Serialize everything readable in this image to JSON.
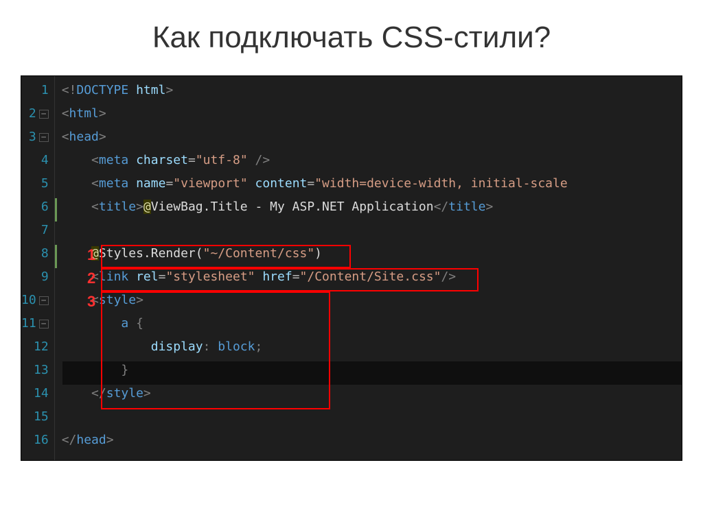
{
  "slide": {
    "title": "Как подключать CSS-стили?"
  },
  "highlights": {
    "label1": "1",
    "label2": "2",
    "label3": "3"
  },
  "lines": [
    {
      "num": "1",
      "fold": "",
      "tokens": [
        {
          "cls": "tok-punc",
          "t": "<!"
        },
        {
          "cls": "tok-tag",
          "t": "DOCTYPE"
        },
        {
          "cls": "tok-plain",
          "t": " "
        },
        {
          "cls": "tok-attr",
          "t": "html"
        },
        {
          "cls": "tok-punc",
          "t": ">"
        }
      ]
    },
    {
      "num": "2",
      "fold": "−",
      "tokens": [
        {
          "cls": "tok-punc",
          "t": "<"
        },
        {
          "cls": "tok-tag",
          "t": "html"
        },
        {
          "cls": "tok-punc",
          "t": ">"
        }
      ]
    },
    {
      "num": "3",
      "fold": "−",
      "tokens": [
        {
          "cls": "tok-punc",
          "t": "<"
        },
        {
          "cls": "tok-tag",
          "t": "head"
        },
        {
          "cls": "tok-punc",
          "t": ">"
        }
      ]
    },
    {
      "num": "4",
      "fold": "",
      "tokens": [
        {
          "cls": "tok-plain",
          "t": "    "
        },
        {
          "cls": "tok-punc",
          "t": "<"
        },
        {
          "cls": "tok-tag",
          "t": "meta"
        },
        {
          "cls": "tok-plain",
          "t": " "
        },
        {
          "cls": "tok-attr",
          "t": "charset"
        },
        {
          "cls": "tok-op",
          "t": "="
        },
        {
          "cls": "tok-str",
          "t": "\"utf-8\""
        },
        {
          "cls": "tok-plain",
          "t": " "
        },
        {
          "cls": "tok-punc",
          "t": "/>"
        }
      ]
    },
    {
      "num": "5",
      "fold": "",
      "tokens": [
        {
          "cls": "tok-plain",
          "t": "    "
        },
        {
          "cls": "tok-punc",
          "t": "<"
        },
        {
          "cls": "tok-tag",
          "t": "meta"
        },
        {
          "cls": "tok-plain",
          "t": " "
        },
        {
          "cls": "tok-attr",
          "t": "name"
        },
        {
          "cls": "tok-op",
          "t": "="
        },
        {
          "cls": "tok-str",
          "t": "\"viewport\""
        },
        {
          "cls": "tok-plain",
          "t": " "
        },
        {
          "cls": "tok-attr",
          "t": "content"
        },
        {
          "cls": "tok-op",
          "t": "="
        },
        {
          "cls": "tok-str",
          "t": "\"width=device-width, initial-scale"
        }
      ]
    },
    {
      "num": "6",
      "fold": "",
      "tokens": [
        {
          "cls": "tok-plain",
          "t": "    "
        },
        {
          "cls": "tok-punc",
          "t": "<"
        },
        {
          "cls": "tok-tag",
          "t": "title"
        },
        {
          "cls": "tok-punc",
          "t": ">"
        },
        {
          "cls": "tok-razor",
          "t": "@"
        },
        {
          "cls": "tok-plain",
          "t": "ViewBag.Title - My ASP.NET Application"
        },
        {
          "cls": "tok-punc",
          "t": "</"
        },
        {
          "cls": "tok-tag",
          "t": "title"
        },
        {
          "cls": "tok-punc",
          "t": ">"
        }
      ]
    },
    {
      "num": "7",
      "fold": "",
      "tokens": []
    },
    {
      "num": "8",
      "fold": "",
      "tokens": [
        {
          "cls": "tok-plain",
          "t": "    "
        },
        {
          "cls": "tok-razor",
          "t": "@"
        },
        {
          "cls": "tok-plain",
          "t": "Styles.Render("
        },
        {
          "cls": "tok-str",
          "t": "\"~/Content/css\""
        },
        {
          "cls": "tok-plain",
          "t": ")"
        }
      ]
    },
    {
      "num": "9",
      "fold": "",
      "tokens": [
        {
          "cls": "tok-plain",
          "t": "    "
        },
        {
          "cls": "tok-punc",
          "t": "<"
        },
        {
          "cls": "tok-tag",
          "t": "link"
        },
        {
          "cls": "tok-plain",
          "t": " "
        },
        {
          "cls": "tok-attr",
          "t": "rel"
        },
        {
          "cls": "tok-op",
          "t": "="
        },
        {
          "cls": "tok-str",
          "t": "\"stylesheet\""
        },
        {
          "cls": "tok-plain",
          "t": " "
        },
        {
          "cls": "tok-attr",
          "t": "href"
        },
        {
          "cls": "tok-op",
          "t": "="
        },
        {
          "cls": "tok-str",
          "t": "\"/Content/Site.css\""
        },
        {
          "cls": "tok-punc",
          "t": "/>"
        }
      ]
    },
    {
      "num": "10",
      "fold": "−",
      "tokens": [
        {
          "cls": "tok-plain",
          "t": "    "
        },
        {
          "cls": "tok-punc",
          "t": "<"
        },
        {
          "cls": "tok-tag",
          "t": "style"
        },
        {
          "cls": "tok-punc",
          "t": ">"
        }
      ]
    },
    {
      "num": "11",
      "fold": "−",
      "tokens": [
        {
          "cls": "tok-plain",
          "t": "        "
        },
        {
          "cls": "tok-tag",
          "t": "a"
        },
        {
          "cls": "tok-plain",
          "t": " "
        },
        {
          "cls": "tok-punc",
          "t": "{"
        }
      ]
    },
    {
      "num": "12",
      "fold": "",
      "tokens": [
        {
          "cls": "tok-plain",
          "t": "            "
        },
        {
          "cls": "tok-prop",
          "t": "display"
        },
        {
          "cls": "tok-punc",
          "t": ":"
        },
        {
          "cls": "tok-plain",
          "t": " "
        },
        {
          "cls": "tok-key",
          "t": "block"
        },
        {
          "cls": "tok-punc",
          "t": ";"
        }
      ]
    },
    {
      "num": "13",
      "fold": "",
      "tokens": [
        {
          "cls": "tok-plain",
          "t": "        "
        },
        {
          "cls": "tok-punc",
          "t": "}"
        }
      ]
    },
    {
      "num": "14",
      "fold": "",
      "tokens": [
        {
          "cls": "tok-plain",
          "t": "    "
        },
        {
          "cls": "tok-punc",
          "t": "</"
        },
        {
          "cls": "tok-tag",
          "t": "style"
        },
        {
          "cls": "tok-punc",
          "t": ">"
        }
      ]
    },
    {
      "num": "15",
      "fold": "",
      "tokens": []
    },
    {
      "num": "16",
      "fold": "",
      "tokens": [
        {
          "cls": "tok-punc",
          "t": "</"
        },
        {
          "cls": "tok-tag",
          "t": "head"
        },
        {
          "cls": "tok-punc",
          "t": ">"
        }
      ]
    }
  ]
}
